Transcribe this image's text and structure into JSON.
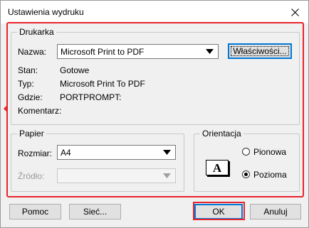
{
  "window": {
    "title": "Ustawienia wydruku",
    "close_icon": "close-icon"
  },
  "printer": {
    "legend": "Drukarka",
    "name_label": "Nazwa:",
    "name_value": "Microsoft Print to PDF",
    "properties_button": "Właściwości...",
    "status_label": "Stan:",
    "status_value": "Gotowe",
    "type_label": "Typ:",
    "type_value": "Microsoft Print To PDF",
    "where_label": "Gdzie:",
    "where_value": "PORTPROMPT:",
    "comment_label": "Komentarz:",
    "comment_value": ""
  },
  "paper": {
    "legend": "Papier",
    "size_label": "Rozmiar:",
    "size_value": "A4",
    "source_label": "Źródło:",
    "source_value": ""
  },
  "orientation": {
    "legend": "Orientacja",
    "icon_letter": "A",
    "options": [
      {
        "label": "Pionowa",
        "selected": false
      },
      {
        "label": "Pozioma",
        "selected": true
      }
    ]
  },
  "footer": {
    "help_button": "Pomoc",
    "network_button": "Sieć...",
    "ok_button": "OK",
    "cancel_button": "Anuluj"
  },
  "colors": {
    "highlight": "#e8242b",
    "default_button_border": "#0078d7"
  }
}
